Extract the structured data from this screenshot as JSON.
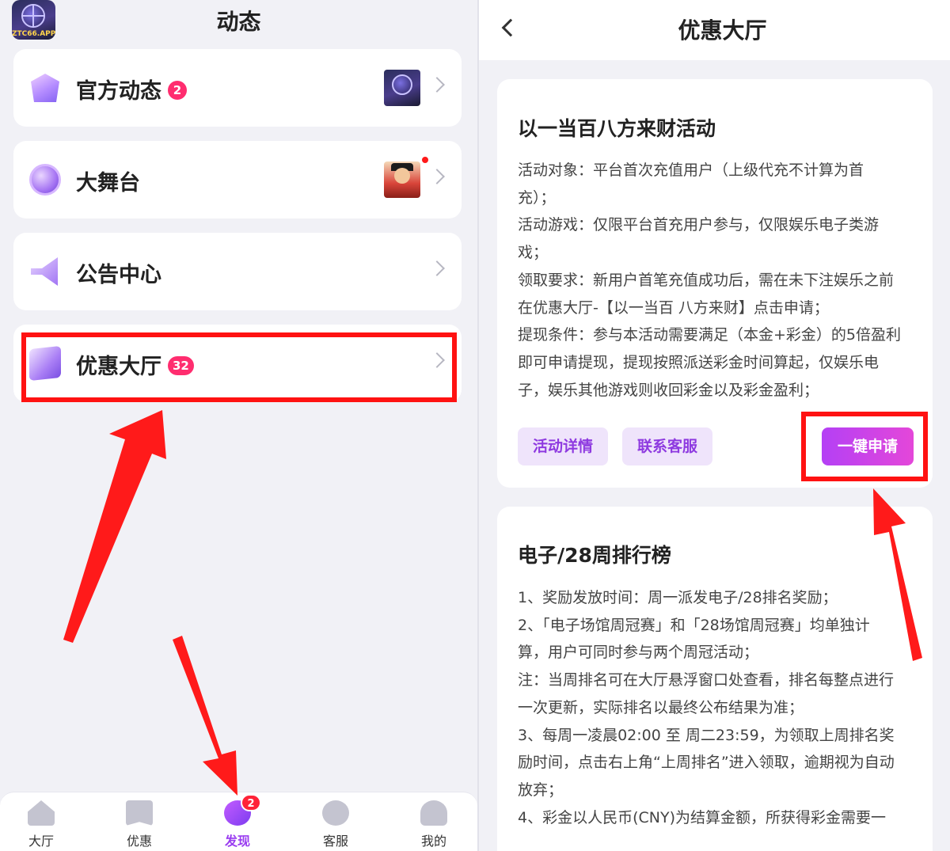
{
  "left": {
    "app_logo_text": "ZTC66.APP",
    "title": "动态",
    "menu": [
      {
        "label": "官方动态",
        "badge": "2",
        "icon": "crown-icon"
      },
      {
        "label": "大舞台",
        "badge": "",
        "icon": "coin-icon"
      },
      {
        "label": "公告中心",
        "badge": "",
        "icon": "megaphone-icon"
      },
      {
        "label": "优惠大厅",
        "badge": "32",
        "icon": "gift-box-icon"
      }
    ],
    "tabbar": [
      {
        "label": "大厅",
        "icon": "home-icon"
      },
      {
        "label": "优惠",
        "icon": "star-bookmark-icon"
      },
      {
        "label": "发现",
        "icon": "discover-icon",
        "badge": "2",
        "active": true
      },
      {
        "label": "客服",
        "icon": "customer-service-icon"
      },
      {
        "label": "我的",
        "icon": "user-icon"
      }
    ]
  },
  "right": {
    "title": "优惠大厅",
    "promo1": {
      "title": "以一当百八方来财活动",
      "lines": [
        " 活动对象：平台首次充值用户（上级代充不计算为首",
        "充）；",
        "活动游戏：仅限平台首充用户参与，仅限娱乐电子类游",
        "戏；",
        "领取要求：新用户首笔充值成功后，需在未下注娱乐之前",
        "在优惠大厅-【以一当百 八方来财】点击申请；",
        "提现条件：参与本活动需要满足（本金+彩金）的5倍盈利",
        "即可申请提现，提现按照派送彩金时间算起，仅娱乐电",
        "子，娱乐其他游戏则收回彩金以及彩金盈利；"
      ],
      "btn_details": "活动详情",
      "btn_contact": "联系客服",
      "btn_apply": "一键申请"
    },
    "promo2": {
      "title": "电子/28周排行榜",
      "lines": [
        " 1、奖励发放时间：周一派发电子/28排名奖励；",
        "2、「电子场馆周冠赛」和「28场馆周冠赛」均单独计",
        "算，用户可同时参与两个周冠活动；",
        "注：当周排名可在大厅悬浮窗口处查看，排名每整点进行",
        "一次更新，实际排名以最终公布结果为准；",
        "3、每周一凌晨02:00 至 周二23:59，为领取上周排名奖",
        "励时间，点击右上角“上周排名”进入领取，逾期视为自动",
        "放弃；",
        "4、彩金以人民币(CNY)为结算金额，所获得彩金需要一"
      ]
    }
  },
  "colors": {
    "accent": "#9a3df0",
    "badge": "#ff2d6f",
    "highlight": "#ff1212",
    "apply_gradient_start": "#b440f5",
    "apply_gradient_end": "#e447d9"
  }
}
